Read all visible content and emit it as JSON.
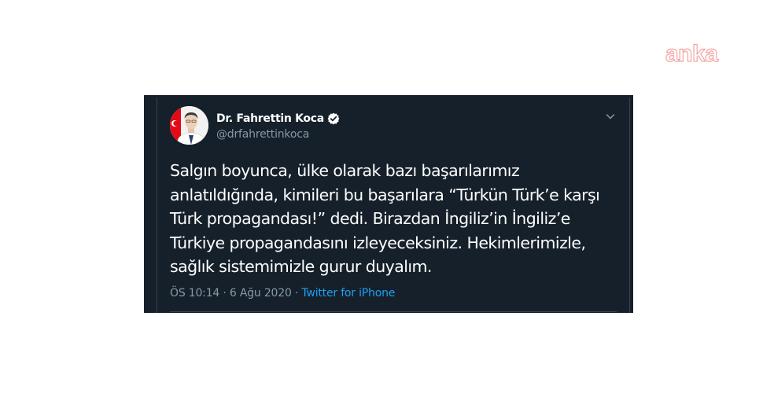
{
  "watermark": {
    "text": "anka",
    "color": "#f29a9a"
  },
  "tweet": {
    "author": {
      "display_name": "Dr. Fahrettin Koca",
      "handle": "@drfahrettinkoca",
      "verified_icon": "verified-badge-icon"
    },
    "text": "Salgın boyunca, ülke olarak bazı başarılarımız\nanlatıldığında, kimileri bu başarılara “Türkün Türk’e karşı\nTürk propagandası!” dedi. Birazdan İngiliz’in İngiliz’e\nTürkiye propagandasını izleyeceksiniz. Hekimlerimizle,\nsağlık sistemimizle gurur duyalım.",
    "time": "ÖS 10:14",
    "separator": " · ",
    "date": "6 Ağu 2020",
    "source": "Twitter for iPhone",
    "menu_icon": "chevron-down-icon"
  },
  "colors": {
    "background": "#15202b",
    "border": "#38444d",
    "text": "#ffffff",
    "secondary": "#8899a6",
    "accent": "#1da1f2"
  }
}
